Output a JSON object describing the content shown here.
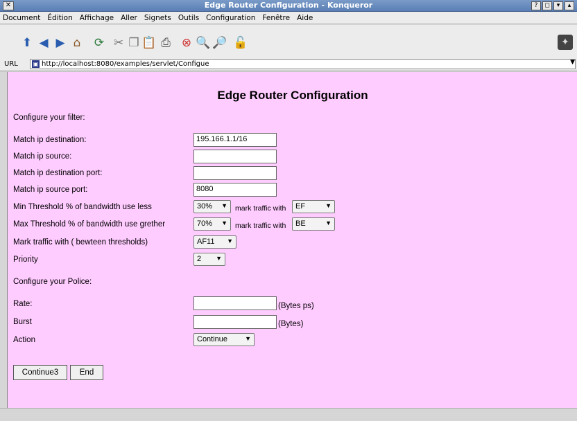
{
  "window": {
    "title": "Edge Router Configuration - Konqueror",
    "close_glyph": "✕",
    "controls": [
      "?",
      "◻",
      "▾",
      "▴"
    ]
  },
  "menu": [
    "Document",
    "Édition",
    "Affichage",
    "Aller",
    "Signets",
    "Outils",
    "Configuration",
    "Fenêtre",
    "Aide"
  ],
  "toolbar": {
    "icons": [
      "up-icon",
      "back-icon",
      "forward-icon",
      "home-icon",
      "reload-icon",
      "cut-icon",
      "copy-icon",
      "paste-icon",
      "print-icon",
      "stop-icon",
      "zoom-in-icon",
      "zoom-out-icon",
      "security-icon"
    ],
    "glyphs": [
      "⬆",
      "◀",
      "▶",
      "⌂",
      "⟳",
      "✂",
      "❐",
      "📋",
      "⎙",
      "⊗",
      "🔍",
      "🔎",
      "🔓"
    ],
    "throbber_glyph": "✦"
  },
  "location": {
    "label": "URL",
    "url": "http://localhost:8080/examples/servlet/Configue"
  },
  "page": {
    "heading": "Edge Router Configuration",
    "filter_section": "Configure your filter:",
    "labels": {
      "dest": "Match ip destination:",
      "src": "Match ip source:",
      "dest_port": "Match ip destination port:",
      "src_port": "Match ip source port:",
      "min_thr": "Min Threshold % of bandwidth use less",
      "max_thr": "Max Threshold % of bandwidth use grether",
      "mark_between": "Mark traffic with ( bewteen thresholds)",
      "priority": "Priority",
      "mark_with": "mark traffic with"
    },
    "values": {
      "dest": "195.166.1.1/16",
      "src": "",
      "dest_port": "",
      "src_port": "8080",
      "min_thr": "30%",
      "min_mark": "EF",
      "max_thr": "70%",
      "max_mark": "BE",
      "mark_between": "AF11",
      "priority": "2"
    },
    "police_section": "Configure your Police:",
    "police": {
      "rate_label": "Rate:",
      "rate_unit": "(Bytes ps)",
      "rate_value": "",
      "burst_label": "Burst",
      "burst_unit": "(Bytes)",
      "burst_value": "",
      "action_label": "Action",
      "action_value": "Continue"
    },
    "buttons": {
      "continue": "Continue3",
      "end": "End"
    }
  },
  "colors": {
    "page_background": "#ffccff",
    "titlebar": "#5a7fb5"
  }
}
